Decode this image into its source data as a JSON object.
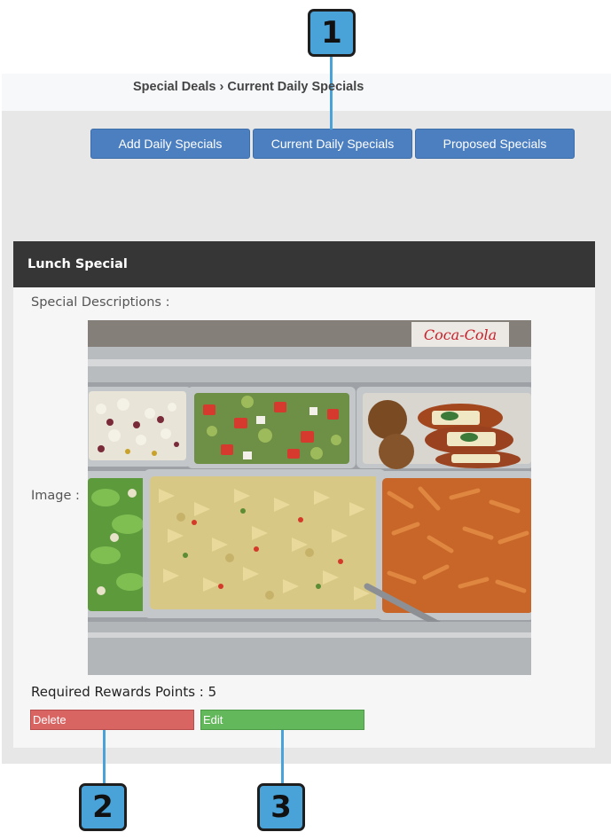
{
  "breadcrumb": {
    "parent": "Special Deals",
    "separator": "›",
    "current": "Current Daily Specials"
  },
  "nav": {
    "add_label": "Add Daily Specials",
    "current_label": "Current Daily Specials",
    "proposed_label": "Proposed Specials"
  },
  "card": {
    "title": "Lunch Special",
    "description_label": "Special Descriptions :",
    "image_label": "Image :",
    "image_sign_text": "Coca-Cola",
    "points_label": "Required Rewards Points : 5",
    "delete_label": "Delete",
    "edit_label": "Edit"
  },
  "callouts": {
    "one": "1",
    "two": "2",
    "three": "3"
  },
  "colors": {
    "nav_button": "#4c7fc0",
    "delete_button": "#d96563",
    "edit_button": "#62b85a",
    "callout": "#4aa3d8",
    "header_bar": "#363636"
  }
}
